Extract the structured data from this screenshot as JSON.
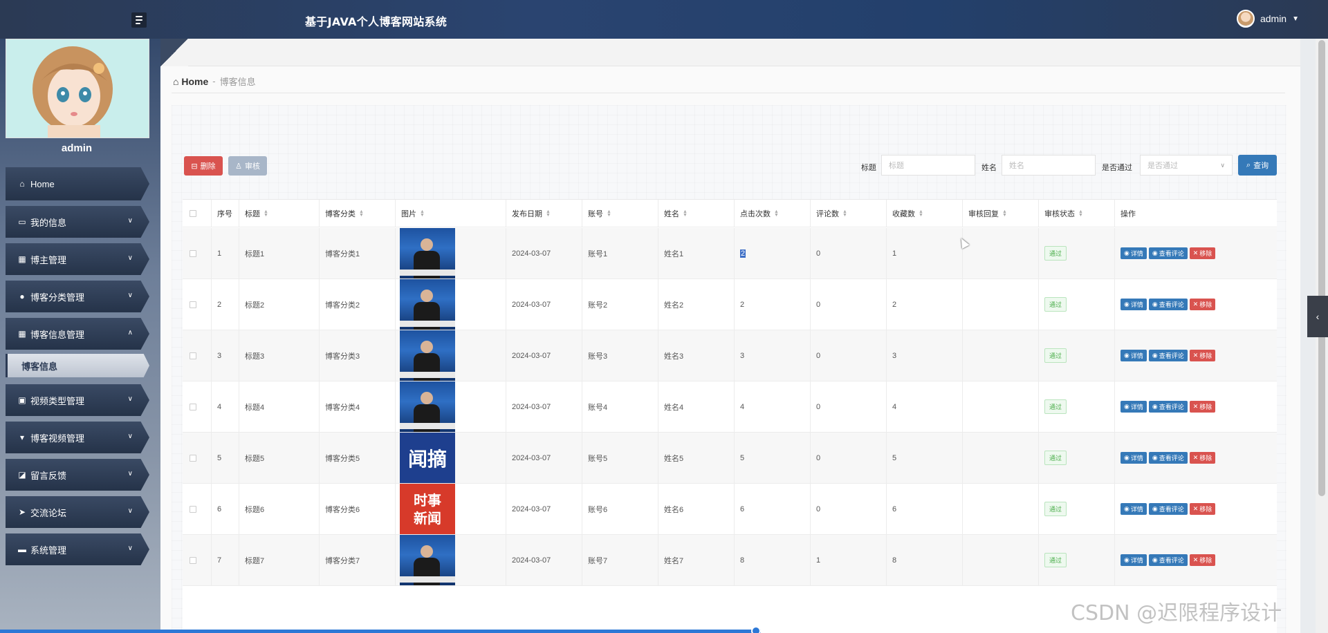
{
  "app": {
    "title": "基于JAVA个人博客网站系统",
    "user": "admin"
  },
  "sidebar": {
    "profile_name": "admin",
    "items": [
      {
        "label": "Home",
        "icon": "home-icon",
        "name": "home"
      },
      {
        "label": "我的信息",
        "icon": "profile-card-icon",
        "name": "my-info"
      },
      {
        "label": "博主管理",
        "icon": "grid-icon",
        "name": "blogger-mgmt"
      },
      {
        "label": "博客分类管理",
        "icon": "bulb-icon",
        "name": "blog-category-mgmt"
      },
      {
        "label": "博客信息管理",
        "icon": "grid-icon",
        "name": "blog-info-mgmt"
      },
      {
        "label": "视频类型管理",
        "icon": "clipboard-icon",
        "name": "video-type-mgmt"
      },
      {
        "label": "博客视频管理",
        "icon": "pin-icon",
        "name": "blog-video-mgmt"
      },
      {
        "label": "留言反馈",
        "icon": "chart-icon",
        "name": "feedback"
      },
      {
        "label": "交流论坛",
        "icon": "send-icon",
        "name": "forum"
      },
      {
        "label": "系统管理",
        "icon": "monitor-icon",
        "name": "system-mgmt"
      }
    ],
    "active_sub": "博客信息"
  },
  "breadcrumb": {
    "home": "Home",
    "separator": "-",
    "current": "博客信息"
  },
  "toolbar": {
    "delete_label": "删除",
    "audit_label": "审核",
    "title_label": "标题",
    "title_placeholder": "标题",
    "name_label": "姓名",
    "name_placeholder": "姓名",
    "pass_label": "是否通过",
    "pass_placeholder": "是否通过",
    "query_label": "查询"
  },
  "table": {
    "columns": [
      "序号",
      "标题",
      "博客分类",
      "图片",
      "发布日期",
      "账号",
      "姓名",
      "点击次数",
      "评论数",
      "收藏数",
      "审核回复",
      "审核状态",
      "操作"
    ],
    "rows": [
      {
        "no": "1",
        "title": "标题1",
        "category": "博客分类1",
        "img": "news",
        "date": "2024-03-07",
        "account": "账号1",
        "name": "姓名1",
        "clicks": "2",
        "comments": "0",
        "favs": "1",
        "reply": "",
        "status": "通过"
      },
      {
        "no": "2",
        "title": "标题2",
        "category": "博客分类2",
        "img": "news",
        "date": "2024-03-07",
        "account": "账号2",
        "name": "姓名2",
        "clicks": "2",
        "comments": "0",
        "favs": "2",
        "reply": "",
        "status": "通过"
      },
      {
        "no": "3",
        "title": "标题3",
        "category": "博客分类3",
        "img": "news",
        "date": "2024-03-07",
        "account": "账号3",
        "name": "姓名3",
        "clicks": "3",
        "comments": "0",
        "favs": "3",
        "reply": "",
        "status": "通过"
      },
      {
        "no": "4",
        "title": "标题4",
        "category": "博客分类4",
        "img": "news",
        "date": "2024-03-07",
        "account": "账号4",
        "name": "姓名4",
        "clicks": "4",
        "comments": "0",
        "favs": "4",
        "reply": "",
        "status": "通过"
      },
      {
        "no": "5",
        "title": "标题5",
        "category": "博客分类5",
        "img": "blue",
        "date": "2024-03-07",
        "account": "账号5",
        "name": "姓名5",
        "clicks": "5",
        "comments": "0",
        "favs": "5",
        "reply": "",
        "status": "通过"
      },
      {
        "no": "6",
        "title": "标题6",
        "category": "博客分类6",
        "img": "red",
        "date": "2024-03-07",
        "account": "账号6",
        "name": "姓名6",
        "clicks": "6",
        "comments": "0",
        "favs": "6",
        "reply": "",
        "status": "通过"
      },
      {
        "no": "7",
        "title": "标题7",
        "category": "博客分类7",
        "img": "news",
        "date": "2024-03-07",
        "account": "账号7",
        "name": "姓名7",
        "clicks": "8",
        "comments": "1",
        "favs": "8",
        "reply": "",
        "status": "通过"
      }
    ],
    "thumb_text": {
      "blue": "闻摘",
      "red_line1": "时事",
      "red_line2": "新闻"
    },
    "ops": {
      "detail": "详情",
      "view_comments": "查看评论",
      "remove": "移除"
    }
  },
  "watermark": "CSDN @迟限程序设计",
  "colors": {
    "primary": "#3579b8",
    "danger": "#d9534f",
    "success": "#4cae4c",
    "header": "#2a4470"
  }
}
